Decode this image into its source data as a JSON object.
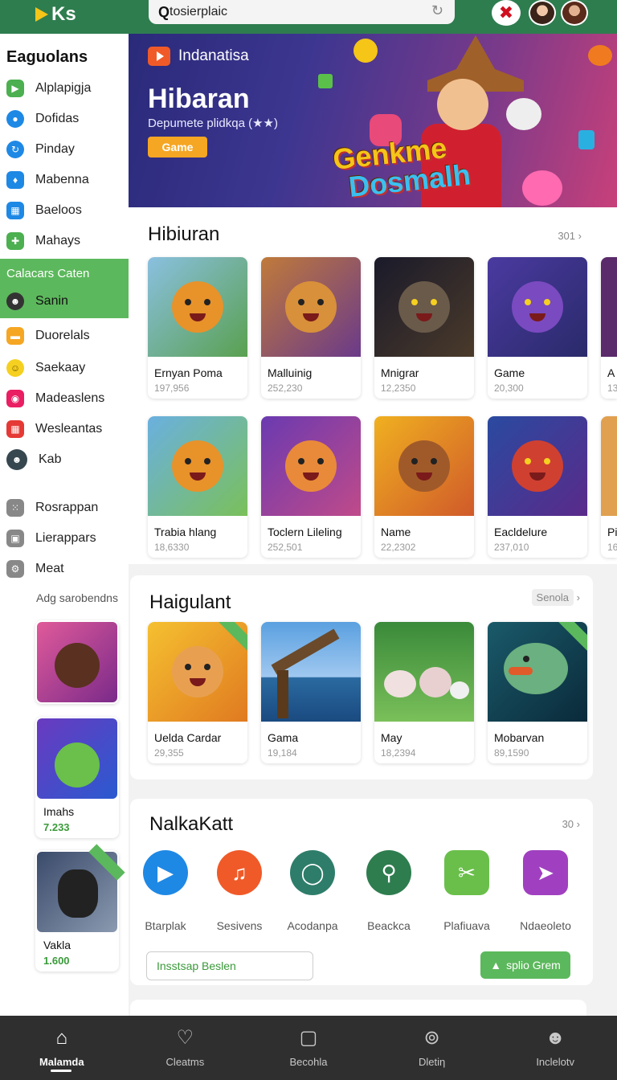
{
  "header": {
    "logo_text": "Ks",
    "search_value": "tosierplaic",
    "search_icon": "Q"
  },
  "sidebar": {
    "title": "Eaguolans",
    "items": [
      {
        "label": "Alplapigja",
        "icon": "play-icon",
        "color": "#4caf50"
      },
      {
        "label": "Dofidas",
        "icon": "chat-icon",
        "color": "#1e88e5"
      },
      {
        "label": "Pinday",
        "icon": "refresh-icon",
        "color": "#1e88e5"
      },
      {
        "label": "Mabenna",
        "icon": "location-icon",
        "color": "#1e88e5"
      },
      {
        "label": "Baeloos",
        "icon": "calendar-icon",
        "color": "#1e88e5"
      },
      {
        "label": "Mahays",
        "icon": "puzzle-icon",
        "color": "#4caf50"
      }
    ],
    "section": {
      "title": "Calacars Caten",
      "item_label": "Sanin"
    },
    "items2": [
      {
        "label": "Duorelals",
        "icon": "folder-icon",
        "color": "#f5a623"
      },
      {
        "label": "Saekaay",
        "icon": "smiley-icon",
        "color": "#f5d020"
      },
      {
        "label": "Madeaslens",
        "icon": "camera-icon",
        "color": "#e91e63"
      },
      {
        "label": "Wesleantas",
        "icon": "grid-icon",
        "color": "#e53935"
      },
      {
        "label": "Kab",
        "icon": "user-icon",
        "color": "#37474f"
      }
    ],
    "items3": [
      {
        "label": "Rosrappan",
        "icon": "apps-icon",
        "color": "#888888"
      },
      {
        "label": "Lierappars",
        "icon": "store-icon",
        "color": "#888888"
      },
      {
        "label": "Meat",
        "icon": "settings-icon",
        "color": "#888888"
      }
    ],
    "sub_title": "Adg sarobendns",
    "cards": [
      {
        "title": "",
        "meta": ""
      },
      {
        "title": "Imahs",
        "meta": "7.233"
      },
      {
        "title": "Vakla",
        "meta": "1.600"
      }
    ]
  },
  "banner": {
    "brand": "Indanatisa",
    "title": "Hibaran",
    "subtitle": "Depumete plidkqa (★★)",
    "button": "Game",
    "logo_line1": "Genkme",
    "logo_line2": "Dosmalh"
  },
  "section1": {
    "title": "Hibiuran",
    "more": "301",
    "rows": [
      [
        {
          "title": "Ernyan Poma",
          "meta": "197,956"
        },
        {
          "title": "Malluinig",
          "meta": "252,230"
        },
        {
          "title": "Mnigrar",
          "meta": "12,2350"
        },
        {
          "title": "Game",
          "meta": "20,300"
        },
        {
          "title": "A",
          "meta": "13"
        }
      ],
      [
        {
          "title": "Trabia hlang",
          "meta": "18,6330"
        },
        {
          "title": "Toclern Lileling",
          "meta": "252,501"
        },
        {
          "title": "Name",
          "meta": "22,2302"
        },
        {
          "title": "Eacldelure",
          "meta": "237,010"
        },
        {
          "title": "Pi",
          "meta": "16"
        }
      ]
    ]
  },
  "section2": {
    "title": "Haigulant",
    "more": "Senola",
    "tiles": [
      {
        "title": "Uelda Cardar",
        "meta": "29,355"
      },
      {
        "title": "Gama",
        "meta": "19,184"
      },
      {
        "title": "May",
        "meta": "18,2394"
      },
      {
        "title": "Mobarvan",
        "meta": "89,1590"
      }
    ]
  },
  "section3": {
    "title": "NalkaKatt",
    "more": "30",
    "apps": [
      {
        "label": "Btarplak",
        "icon": "play-icon",
        "color": "#1e88e5"
      },
      {
        "label": "Sesivens",
        "icon": "music-icon",
        "color": "#f05a28"
      },
      {
        "label": "Acodanpa",
        "icon": "chat-icon",
        "color": "#2e7d6a"
      },
      {
        "label": "Beackca",
        "icon": "pin-icon",
        "color": "#2e7d4f"
      },
      {
        "label": "Plafiuava",
        "icon": "tools-icon",
        "color": "#6abf4b"
      },
      {
        "label": "Ndaeoleto",
        "icon": "send-icon",
        "color": "#a040c0"
      }
    ],
    "input_placeholder": "Insstsap Beslen",
    "button": "splio Grem"
  },
  "bottom_nav": [
    {
      "label": "Malamda",
      "icon": "home-icon",
      "active": true
    },
    {
      "label": "Cleatms",
      "icon": "heart-icon",
      "active": false
    },
    {
      "label": "Becohla",
      "icon": "book-icon",
      "active": false
    },
    {
      "label": "Dletiη",
      "icon": "search-icon",
      "active": false
    },
    {
      "label": "Inclelotv",
      "icon": "profile-icon",
      "active": false
    }
  ]
}
